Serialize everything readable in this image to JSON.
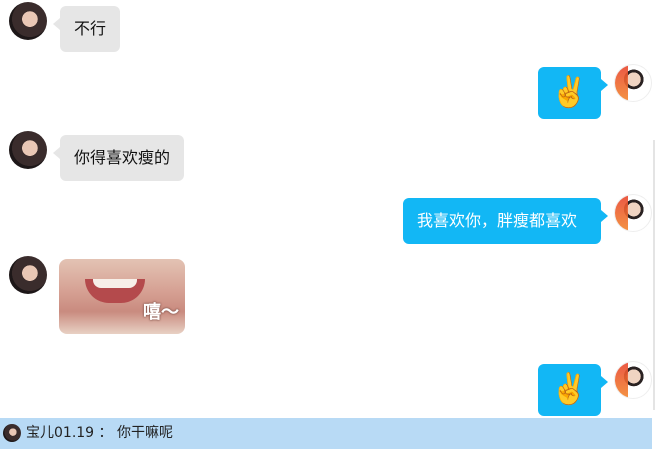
{
  "messages": [
    {
      "sender": "her",
      "type": "text",
      "text": "不行"
    },
    {
      "sender": "me",
      "type": "emoji",
      "text": "✌️"
    },
    {
      "sender": "her",
      "type": "text",
      "text": "你得喜欢瘦的"
    },
    {
      "sender": "me",
      "type": "text",
      "text": "我喜欢你，胖瘦都喜欢"
    },
    {
      "sender": "her",
      "type": "sticker",
      "text": "嘻～"
    },
    {
      "sender": "me",
      "type": "emoji",
      "text": "✌️"
    }
  ],
  "status_bar": {
    "preview": "宝儿01.19 ： 你干嘛呢"
  },
  "colors": {
    "outgoing_bubble": "#12b7f5",
    "incoming_bubble": "#e6e6e6",
    "status_bar": "#b8daf5"
  }
}
